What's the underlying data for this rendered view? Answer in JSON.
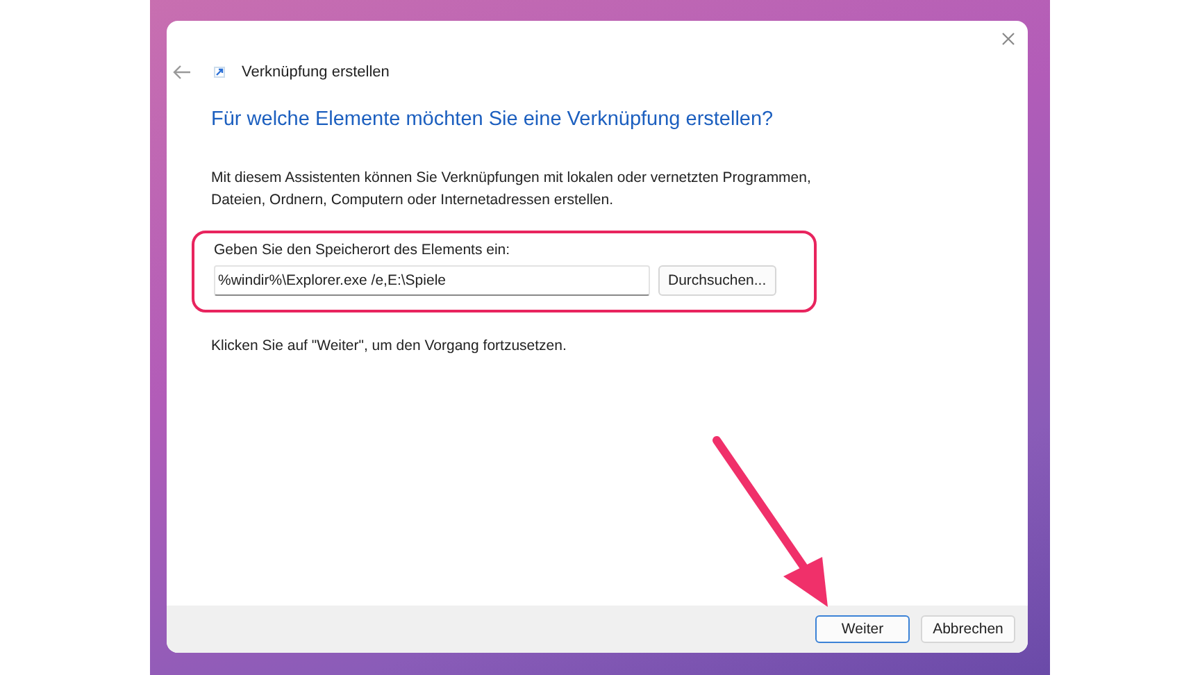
{
  "window": {
    "title": "Verknüpfung erstellen"
  },
  "heading": "Für welche Elemente möchten Sie eine Verknüpfung erstellen?",
  "intro": "Mit diesem Assistenten können Sie Verknüpfungen mit lokalen oder vernetzten Programmen, Dateien, Ordnern, Computern oder Internetadressen erstellen.",
  "location": {
    "label": "Geben Sie den Speicherort des Elements ein:",
    "value": "%windir%\\Explorer.exe /e,E:\\Spiele",
    "browse_button": "Durchsuchen...",
    "highlighted": true
  },
  "hint": "Klicken Sie auf \"Weiter\", um den Vorgang fortzusetzen.",
  "buttons": [
    {
      "label": "Weiter",
      "default": true
    },
    {
      "label": "Abbrechen",
      "default": false
    }
  ]
}
